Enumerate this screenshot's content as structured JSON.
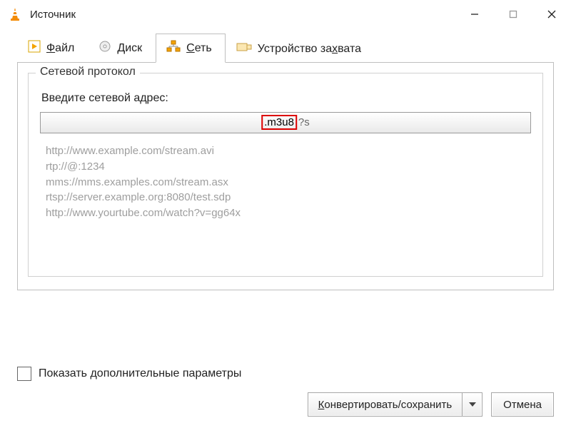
{
  "window": {
    "title": "Источник"
  },
  "tabs": {
    "file": {
      "label_before": "",
      "label_hot": "Ф",
      "label_after": "айл"
    },
    "disc": {
      "label_before": "",
      "label_hot": "Д",
      "label_after": "иск"
    },
    "network": {
      "label_before": "",
      "label_hot": "С",
      "label_after": "еть"
    },
    "capture": {
      "label_before": "Устройство за",
      "label_hot": "х",
      "label_after": "вата"
    },
    "active": "network"
  },
  "group": {
    "title": "Сетевой протокол",
    "prompt": "Введите сетевой адрес:",
    "url_highlight": ".m3u8",
    "url_tail": "?s",
    "examples": [
      "http://www.example.com/stream.avi",
      "rtp://@:1234",
      "mms://mms.examples.com/stream.asx",
      "rtsp://server.example.org:8080/test.sdp",
      "http://www.yourtube.com/watch?v=gg64x"
    ]
  },
  "footer": {
    "show_more": "Показать дополнительные параметры",
    "convert_before": "",
    "convert_hot": "К",
    "convert_after": "онвертировать/сохранить",
    "cancel": "Отмена"
  }
}
